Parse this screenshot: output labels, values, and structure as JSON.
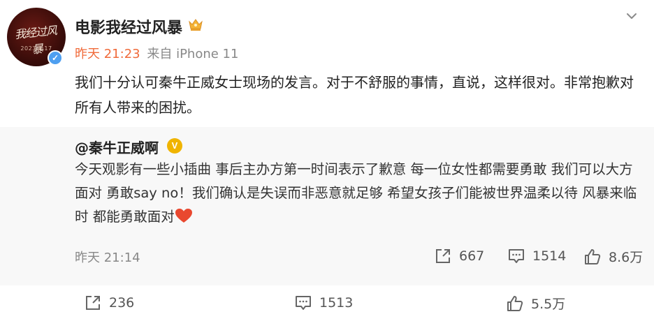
{
  "post": {
    "author": {
      "name": "电影我经过风暴",
      "avatar_title": "我经过风暴",
      "avatar_date": "2023.8.17"
    },
    "time": "昨天 21:23",
    "source": "来自 iPhone 11",
    "text": "我们十分认可秦牛正威女士现场的发言。对于不舒服的事情，直说，这样很对。非常抱歉对所有人带来的困扰。"
  },
  "quoted": {
    "author": "@秦牛正威啊",
    "text": "今天观影有一些小插曲 事后主办方第一时间表示了歉意 每一位女性都需要勇敢 我们可以大方面对 勇敢say no！我们确认是失误而非恶意就足够 希望女孩子们能被世界温柔以待 风暴来临时 都能勇敢面对",
    "time": "昨天 21:14",
    "actions": {
      "repost": "667",
      "comment": "1514",
      "like": "8.6万"
    }
  },
  "actions": {
    "repost": "236",
    "comment": "1513",
    "like": "5.5万"
  },
  "icons": [
    "more-chevron-icon",
    "crown-icon",
    "verified-icon",
    "repost-icon",
    "comment-icon",
    "like-icon",
    "heart-emoji"
  ],
  "colors": {
    "time": "#f06a3a",
    "verified_blue": "#4e9ff0",
    "verified_gold": "#f0b400",
    "quote_bg": "#f8f8f8"
  }
}
